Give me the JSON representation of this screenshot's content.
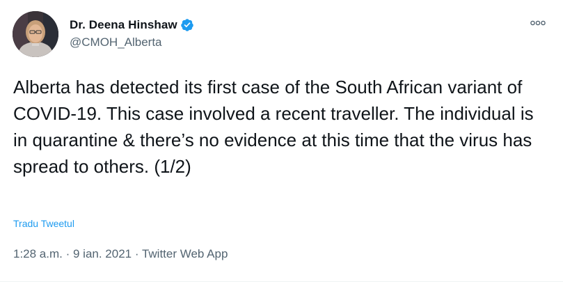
{
  "author": {
    "display_name": "Dr. Deena Hinshaw",
    "handle": "@CMOH_Alberta",
    "avatar_icon": "avatar-photo",
    "verified_icon": "verified-badge-icon",
    "verified_color": "#1d9bf0"
  },
  "menu": {
    "icon": "more-options-icon"
  },
  "tweet": {
    "text": "Alberta has detected its first case of the South African variant of COVID-19. This case involved a recent traveller. The individual is in quarantine & there’s no evidence at this time that the virus has spread to others. (1/2)",
    "translate_label": "Tradu Tweetul"
  },
  "meta": {
    "time": "1:28 a.m.",
    "separator": " · ",
    "date": "9 ian. 2021",
    "source": "Twitter Web App"
  },
  "colors": {
    "link": "#1d9bf0",
    "secondary_text": "#536471",
    "primary_text": "#0f1419"
  }
}
